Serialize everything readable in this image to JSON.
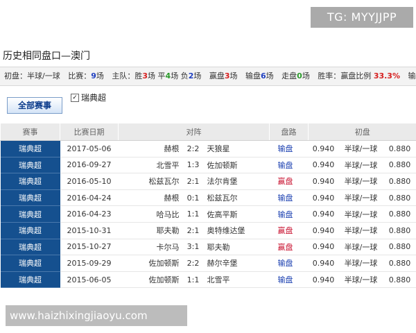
{
  "watermark_top": "TG: MYYJJPP",
  "section_title": "历史相同盘口—澳门",
  "summary": {
    "init_label": "初盘：",
    "init_value": "半球/一球",
    "matches_label": "比赛：",
    "matches_count": "9",
    "matches_unit": "场",
    "home_label": "主队：胜",
    "home_win": "3",
    "draw_label": "场 平",
    "home_draw": "4",
    "lose_label": "场 负",
    "home_lose": "2",
    "home_unit": "场",
    "win_pan_label": "赢盘",
    "win_pan": "3",
    "win_pan_unit": "场",
    "lose_pan_label": "输盘",
    "lose_pan": "6",
    "lose_pan_unit": "场",
    "zou_pan_label": "走盘",
    "zou_pan": "0",
    "zou_pan_unit": "场",
    "rate_label": "胜率：",
    "ratio_label": "赢盘比例",
    "ratio_value": "33.3%",
    "trail_label": "输"
  },
  "filters": {
    "all_button": "全部赛事",
    "league_checkbox": "瑞典超",
    "league_checked": true
  },
  "table": {
    "headers": {
      "league": "赛事",
      "date": "比赛日期",
      "match": "对阵",
      "result": "盘路",
      "initial": "初盘"
    },
    "rows": [
      {
        "league": "瑞典超",
        "date": "2017-05-06",
        "home": "赫根",
        "score": "2:2",
        "away": "天狼星",
        "result": "输盘",
        "outcome": "lose",
        "home_odds": "0.940",
        "line": "半球/一球",
        "away_odds": "0.880"
      },
      {
        "league": "瑞典超",
        "date": "2016-09-27",
        "home": "北雪平",
        "score": "1:3",
        "away": "佐加顿斯",
        "result": "输盘",
        "outcome": "lose",
        "home_odds": "0.940",
        "line": "半球/一球",
        "away_odds": "0.880"
      },
      {
        "league": "瑞典超",
        "date": "2016-05-10",
        "home": "松兹瓦尔",
        "score": "2:1",
        "away": "法尔肯堡",
        "result": "赢盘",
        "outcome": "win",
        "home_odds": "0.940",
        "line": "半球/一球",
        "away_odds": "0.880"
      },
      {
        "league": "瑞典超",
        "date": "2016-04-24",
        "home": "赫根",
        "score": "0:1",
        "away": "松兹瓦尔",
        "result": "输盘",
        "outcome": "lose",
        "home_odds": "0.940",
        "line": "半球/一球",
        "away_odds": "0.880"
      },
      {
        "league": "瑞典超",
        "date": "2016-04-23",
        "home": "哈马比",
        "score": "1:1",
        "away": "佐高平斯",
        "result": "输盘",
        "outcome": "lose",
        "home_odds": "0.940",
        "line": "半球/一球",
        "away_odds": "0.880"
      },
      {
        "league": "瑞典超",
        "date": "2015-10-31",
        "home": "耶夫勒",
        "score": "2:1",
        "away": "奥特维达堡",
        "result": "赢盘",
        "outcome": "win",
        "home_odds": "0.940",
        "line": "半球/一球",
        "away_odds": "0.880"
      },
      {
        "league": "瑞典超",
        "date": "2015-10-27",
        "home": "卡尔马",
        "score": "3:1",
        "away": "耶夫勒",
        "result": "赢盘",
        "outcome": "win",
        "home_odds": "0.940",
        "line": "半球/一球",
        "away_odds": "0.880"
      },
      {
        "league": "瑞典超",
        "date": "2015-09-29",
        "home": "佐加顿斯",
        "score": "2:2",
        "away": "赫尔辛堡",
        "result": "输盘",
        "outcome": "lose",
        "home_odds": "0.940",
        "line": "半球/一球",
        "away_odds": "0.880"
      },
      {
        "league": "瑞典超",
        "date": "2015-06-05",
        "home": "佐加顿斯",
        "score": "1:1",
        "away": "北雪平",
        "result": "输盘",
        "outcome": "lose",
        "home_odds": "0.940",
        "line": "半球/一球",
        "away_odds": "0.880"
      }
    ]
  },
  "watermark_bottom": "www.haizhixingjiaoyu.com",
  "colors": {
    "league_bg": "#15508f",
    "win_text": "#c8102e",
    "lose_text": "#1a3fb0",
    "count_red": "#d62020",
    "count_green": "#2a9a2a",
    "count_blue": "#2040c0"
  }
}
